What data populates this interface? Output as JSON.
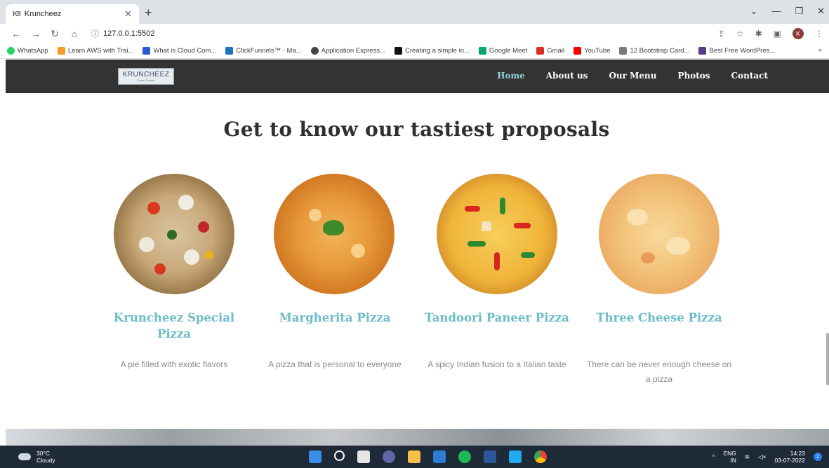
{
  "browser": {
    "tab_title": "Kruncheez",
    "tab_favicon": "K8",
    "new_tab": "+",
    "address": "127.0.0.1:5502",
    "bookmarks": [
      {
        "label": "WhatsApp",
        "color": "#25d366"
      },
      {
        "label": "Learn AWS with Trai...",
        "color": "#f59b23"
      },
      {
        "label": "What is Cloud Com...",
        "color": "#2a5bd7"
      },
      {
        "label": "ClickFunnels™ - Ma...",
        "color": "#1e73be"
      },
      {
        "label": "Application Express...",
        "color": "#444444"
      },
      {
        "label": "Creating a simple in...",
        "color": "#111111"
      },
      {
        "label": "Google Meet",
        "color": "#00a86b"
      },
      {
        "label": "Gmail",
        "color": "#d93025"
      },
      {
        "label": "YouTube",
        "color": "#ff0000"
      },
      {
        "label": "12 Bootstrap Card...",
        "color": "#7a7a7a"
      },
      {
        "label": "Best Free WordPres...",
        "color": "#5b3a8a"
      }
    ],
    "more_bookmarks": "»",
    "profile_initial": "K"
  },
  "site": {
    "logo": {
      "word": "KRUNCHEEZ",
      "sub": "Crave Cheese"
    },
    "nav": {
      "home": "Home",
      "about": "About us",
      "menu": "Our Menu",
      "photos": "Photos",
      "contact": "Contact"
    },
    "heading": "Get to know our tastiest proposals",
    "pizzas": [
      {
        "title": "Kruncheez Special Pizza",
        "desc": "A pie filled with exotic flavors"
      },
      {
        "title": "Margherita Pizza",
        "desc": "A pizza that is personal to everyone"
      },
      {
        "title": "Tandoori Paneer Pizza",
        "desc": "A spicy Indian fusion to a Italian taste"
      },
      {
        "title": "Three Cheese Pizza",
        "desc": "There can be never enough cheese on a pizza"
      }
    ]
  },
  "taskbar": {
    "temperature": "30°C",
    "condition": "Cloudy",
    "language": "ENG",
    "region": "IN",
    "time": "14:23",
    "date": "03-07-2022",
    "notifications": "2"
  },
  "colors": {
    "accent": "#6cbcc9",
    "nav_bg": "#333333",
    "nav_active": "#8fd3dc"
  }
}
